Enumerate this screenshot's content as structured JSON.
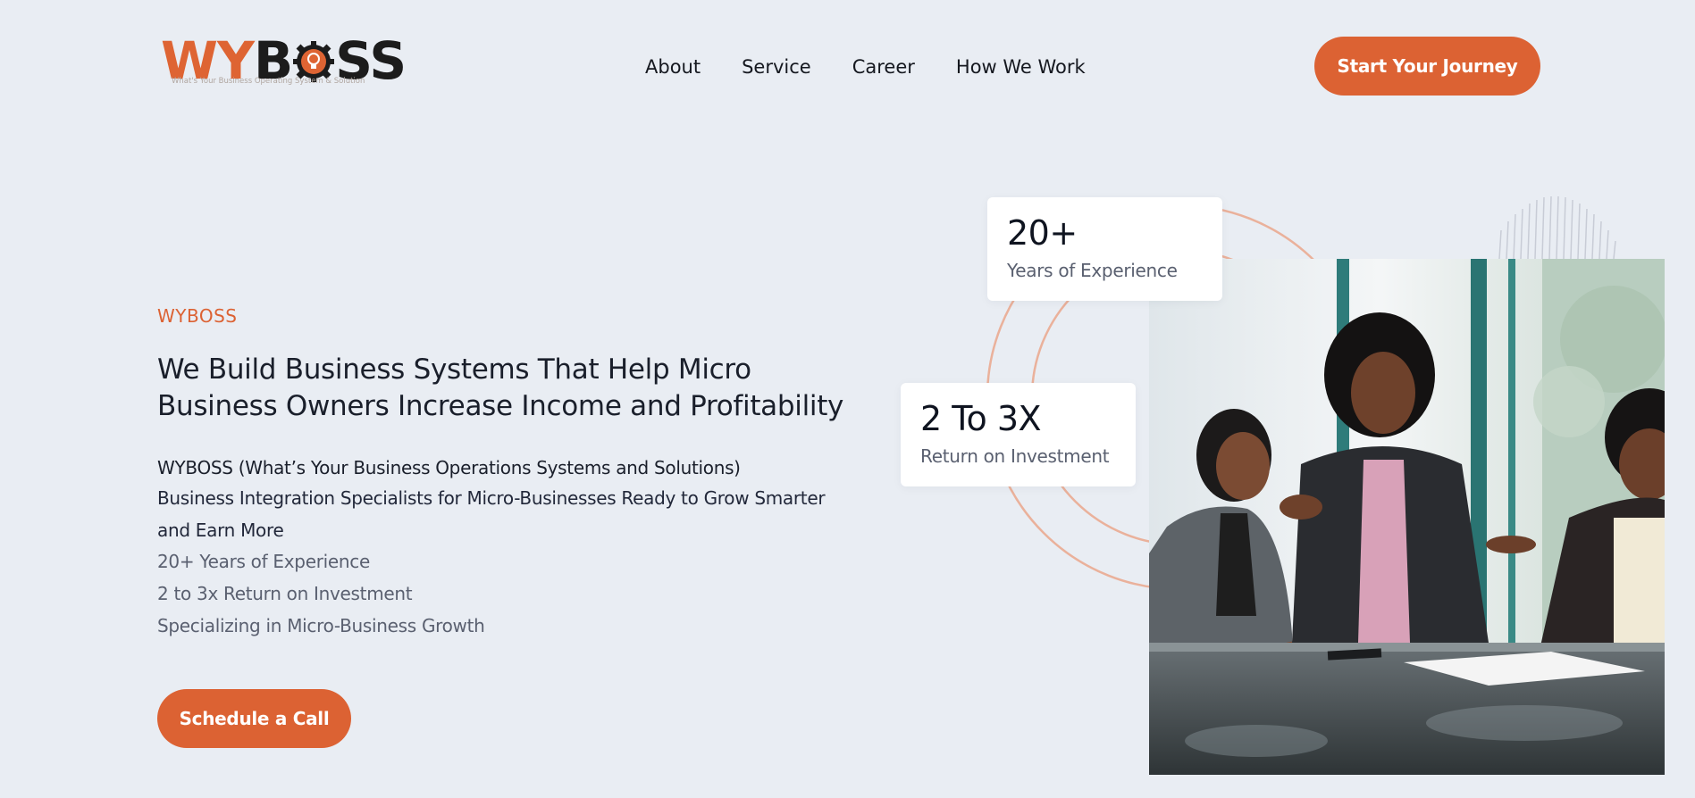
{
  "brand": {
    "name_part1": "WY",
    "name_part2": "B",
    "name_part3": "SS",
    "tagline": "What's Your Business Operating System & Solution",
    "accent": "#dc6233"
  },
  "nav": {
    "items": [
      {
        "label": "About"
      },
      {
        "label": "Service"
      },
      {
        "label": "Career"
      },
      {
        "label": "How We Work"
      }
    ]
  },
  "header": {
    "cta_label": "Start Your Journey"
  },
  "hero": {
    "eyebrow": "WYBOSS",
    "headline": "We Build Business Systems That Help Micro Business Owners Increase Income and Profitability",
    "subtitle": "WYBOSS (What’s Your Business Operations Systems and Solutions)",
    "description": "Business Integration Specialists for Micro-Businesses Ready to Grow Smarter and Earn More",
    "bullets": [
      "20+ Years of Experience",
      "2 to 3x Return on Investment",
      "Specializing in Micro-Business Growth"
    ],
    "cta_label": "Schedule a Call"
  },
  "stats": [
    {
      "value": "20+",
      "label": "Years of Experience"
    },
    {
      "value": "2 To 3X",
      "label": "Return on Investment"
    }
  ],
  "image": {
    "subject": "meeting-photo"
  }
}
